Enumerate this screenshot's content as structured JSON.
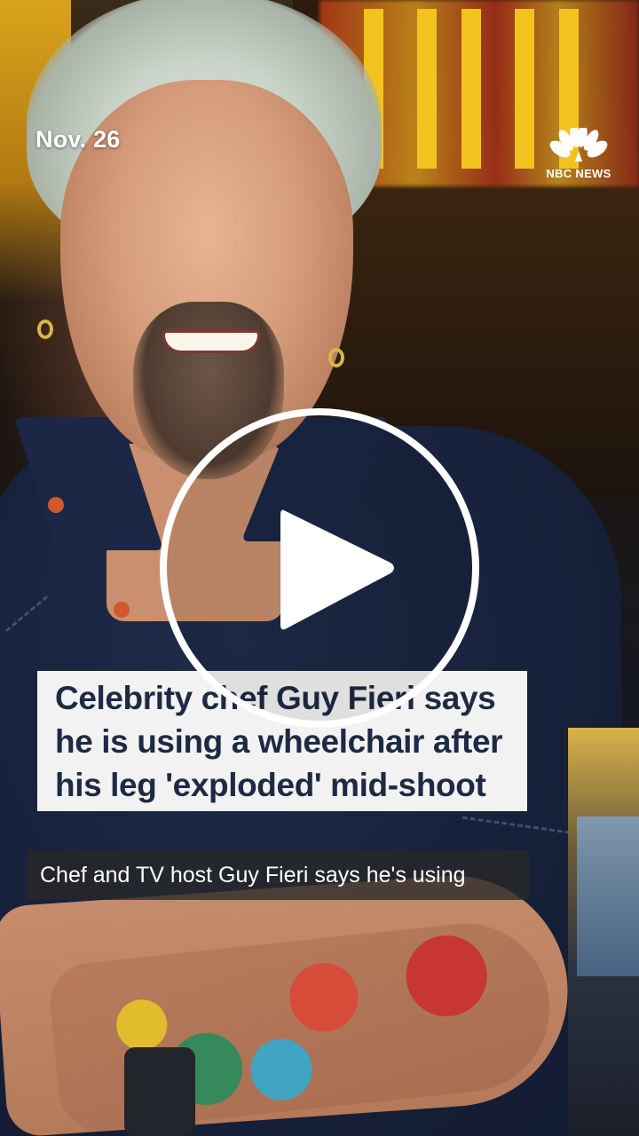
{
  "video": {
    "date": "Nov. 26",
    "brand": {
      "name": "NBC NEWS",
      "logo_icon": "peacock-icon",
      "peacock_colors": [
        "#ffffff",
        "#ffffff",
        "#ffffff",
        "#ffffff",
        "#ffffff",
        "#ffffff"
      ]
    },
    "headline": {
      "lines": [
        "Celebrity chef Guy Fieri says",
        "he is using a wheelchair after",
        "his leg 'exploded' mid-shoot"
      ]
    },
    "caption": "Chef and TV host Guy Fieri says he's using",
    "play_button": {
      "icon": "play-icon"
    }
  },
  "colors": {
    "headline_text": "#1e2a44",
    "headline_bg": "#f2f2f2",
    "caption_bg": "rgba(40,40,40,0.78)",
    "overlay_text": "#ffffff"
  }
}
